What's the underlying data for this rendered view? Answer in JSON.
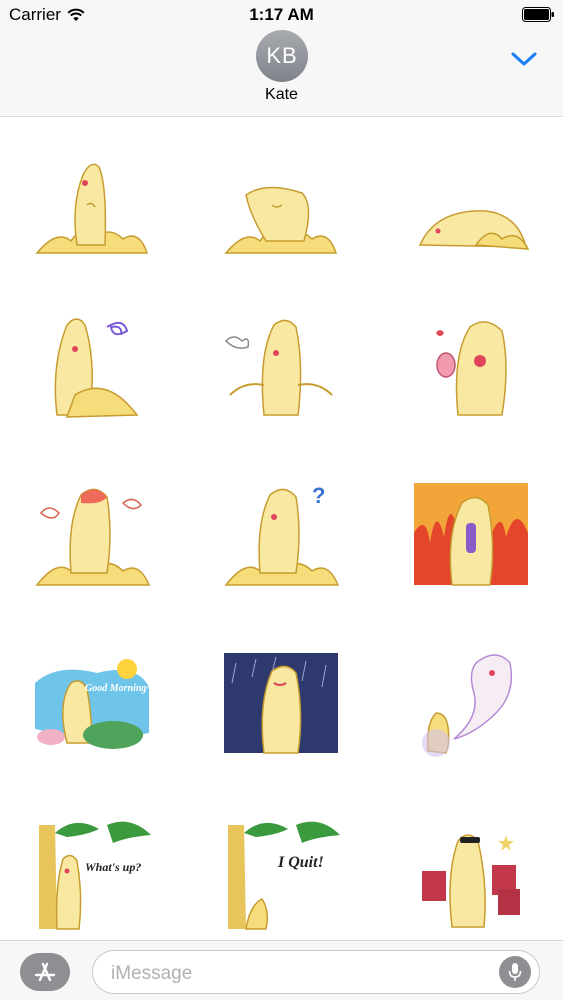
{
  "status_bar": {
    "carrier": "Carrier",
    "time": "1:17 AM",
    "icons": [
      "wifi-icon",
      "battery-icon"
    ]
  },
  "header": {
    "avatar_initials": "KB",
    "contact_name": "Kate",
    "collapse_icon": "chevron-down-icon",
    "accent_color": "#1a7ef5"
  },
  "stickers": [
    {
      "name": "banana-blowing-kiss"
    },
    {
      "name": "banana-bowing-head"
    },
    {
      "name": "banana-lying-down"
    },
    {
      "name": "banana-frustrated-scribble"
    },
    {
      "name": "banana-shrugging"
    },
    {
      "name": "banana-makeup-lipstick"
    },
    {
      "name": "banana-angry-steam"
    },
    {
      "name": "banana-confused-question",
      "text": "?"
    },
    {
      "name": "banana-fire-rage"
    },
    {
      "name": "banana-good-morning",
      "text": "Good Morning~"
    },
    {
      "name": "banana-rainy-night"
    },
    {
      "name": "banana-ghost-spirit"
    },
    {
      "name": "banana-whats-up",
      "text": "What's up?"
    },
    {
      "name": "banana-i-quit",
      "text": "I Quit!"
    },
    {
      "name": "banana-shopping-bags"
    }
  ],
  "compose": {
    "placeholder": "iMessage",
    "app_button_icon": "app-store-icon",
    "mic_icon": "microphone-icon"
  },
  "colors": {
    "banana": "#f6dc7a",
    "banana_shade": "#e8b94a",
    "bar_background": "#f7f7f7",
    "avatar_gray": "#8e8e93"
  }
}
